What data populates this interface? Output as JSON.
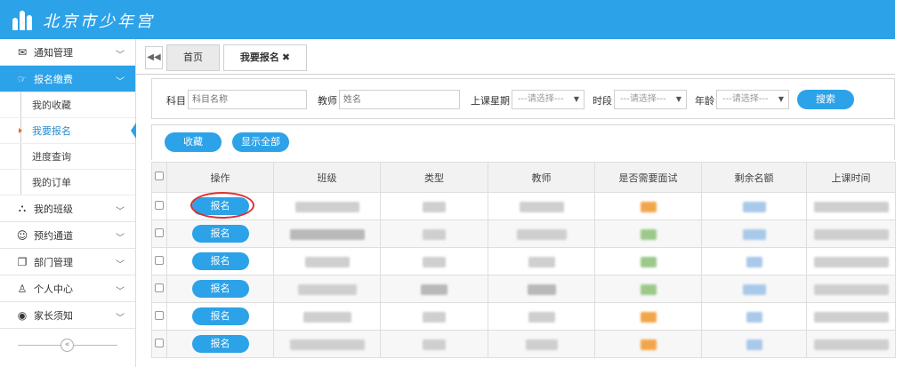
{
  "header": {
    "logo_text": "北京市少年宫"
  },
  "sidebar": {
    "items": [
      {
        "label": "通知管理",
        "icon": "envelope-icon",
        "glyph": "✉"
      },
      {
        "label": "报名缴费",
        "icon": "hand-point-icon",
        "glyph": "☞",
        "active": true
      },
      {
        "label": "我的班级",
        "icon": "org-chart-icon",
        "glyph": "⛬"
      },
      {
        "label": "预约通道",
        "icon": "handshake-icon",
        "glyph": "☺"
      },
      {
        "label": "部门管理",
        "icon": "windows-icon",
        "glyph": "❐"
      },
      {
        "label": "个人中心",
        "icon": "user-icon",
        "glyph": "♙"
      },
      {
        "label": "家长须知",
        "icon": "map-pin-icon",
        "glyph": "◉"
      }
    ],
    "sub_items": [
      {
        "label": "我的收藏"
      },
      {
        "label": "我要报名",
        "current": true
      },
      {
        "label": "进度查询"
      },
      {
        "label": "我的订单"
      }
    ],
    "collapse_glyph": "«"
  },
  "tabs": {
    "back_glyph": "◀◀",
    "home": "首页",
    "current": "我要报名",
    "close_glyph": "✖"
  },
  "search": {
    "subject_label": "科目",
    "subject_placeholder": "科目名称",
    "teacher_label": "教师",
    "teacher_placeholder": "姓名",
    "weekday_label": "上课星期",
    "weekday_value": "---请选择---",
    "period_label": "时段",
    "period_value": "---请选择---",
    "age_label": "年龄",
    "age_value": "---请选择---",
    "search_button": "搜索"
  },
  "actions": {
    "favorite_button": "收藏",
    "show_all_button": "显示全部"
  },
  "table": {
    "columns": [
      "操作",
      "班级",
      "类型",
      "教师",
      "是否需要面试",
      "剩余名额",
      "上课时间"
    ],
    "row_action": "报名",
    "row_count": 6
  },
  "colors": {
    "accent": "#2ca2e8",
    "highlight_ring": "#e03030"
  }
}
